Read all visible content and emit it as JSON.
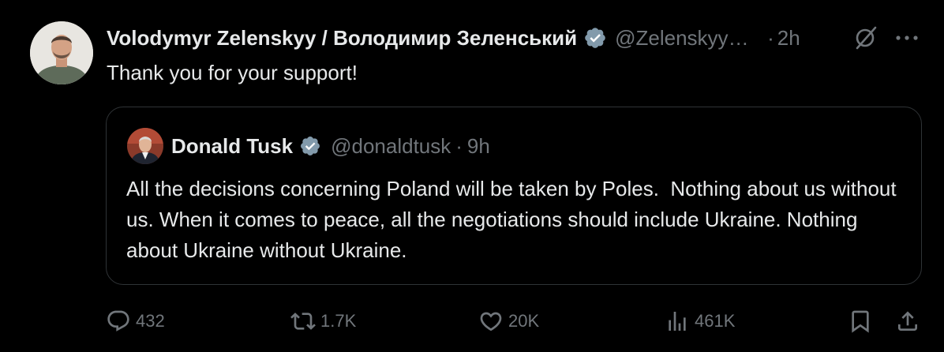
{
  "tweet": {
    "author": {
      "display_name": "Volodymyr Zelenskyy / Володимир Зеленський",
      "handle": "@ZelenskyyUa",
      "verified": true
    },
    "time": "2h",
    "separator": "·",
    "text": "Thank you for your support!",
    "icons": {
      "grok": "grok-icon",
      "more": "more-icon",
      "verified": "verified-badge-icon"
    }
  },
  "quote": {
    "author": {
      "display_name": "Donald Tusk",
      "handle": "@donaldtusk",
      "verified": true
    },
    "separator": "·",
    "time": "9h",
    "text": "All the decisions concerning Poland will be taken by Poles.  Nothing about us without us. When it comes to peace, all the negotiations should include Ukraine. Nothing about Ukraine without Ukraine."
  },
  "actions": {
    "reply": {
      "icon": "reply-icon",
      "count": "432"
    },
    "retweet": {
      "icon": "retweet-icon",
      "count": "1.7K"
    },
    "like": {
      "icon": "heart-icon",
      "count": "20K"
    },
    "views": {
      "icon": "views-chart-icon",
      "count": "461K"
    },
    "bookmark": {
      "icon": "bookmark-icon"
    },
    "share": {
      "icon": "share-icon"
    }
  },
  "colors": {
    "background": "#000000",
    "text_primary": "#e7e9ea",
    "text_secondary": "#71767b",
    "border": "#2f3336",
    "verified_badge": "#829aab"
  }
}
